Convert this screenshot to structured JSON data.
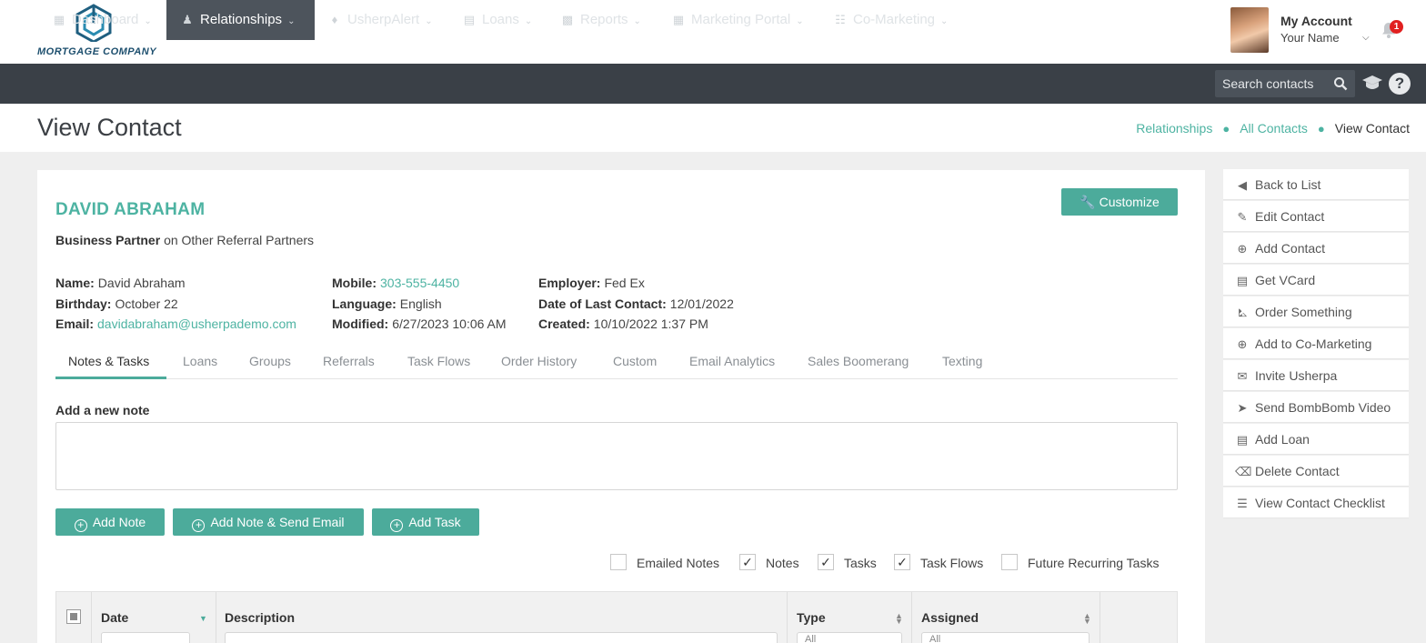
{
  "brand": {
    "logo_text": "MORTGAGE COMPANY"
  },
  "account": {
    "title": "My Account",
    "name": "Your Name",
    "notifications": "1"
  },
  "nav": {
    "items": [
      {
        "label": "Dashboard"
      },
      {
        "label": "Relationships"
      },
      {
        "label": "UsherpAlert"
      },
      {
        "label": "Loans"
      },
      {
        "label": "Reports"
      },
      {
        "label": "Marketing Portal"
      },
      {
        "label": "Co-Marketing"
      }
    ],
    "search_placeholder": "Search contacts"
  },
  "page": {
    "title": "View Contact"
  },
  "breadcrumb": {
    "items": [
      "Relationships",
      "All Contacts"
    ],
    "current": "View Contact"
  },
  "contact": {
    "name": "DAVID ABRAHAM",
    "role": "Business Partner",
    "on_text": "on Other Referral Partners",
    "customize_label": "Customize",
    "fields": {
      "name": {
        "label": "Name:",
        "value": "David Abraham"
      },
      "birthday": {
        "label": "Birthday:",
        "value": "October 22"
      },
      "email": {
        "label": "Email:",
        "value": "davidabraham@usherpademo.com"
      },
      "mobile": {
        "label": "Mobile:",
        "value": "303-555-4450"
      },
      "language": {
        "label": "Language:",
        "value": "English"
      },
      "modified": {
        "label": "Modified:",
        "value": "6/27/2023 10:06 AM"
      },
      "employer": {
        "label": "Employer:",
        "value": "Fed Ex"
      },
      "last_contact": {
        "label": "Date of Last Contact:",
        "value": "12/01/2022"
      },
      "created": {
        "label": "Created:",
        "value": "10/10/2022 1:37 PM"
      }
    }
  },
  "tabs": [
    "Notes & Tasks",
    "Loans",
    "Groups",
    "Referrals",
    "Task Flows",
    "Order History",
    "Custom",
    "Email Analytics",
    "Sales Boomerang",
    "Texting"
  ],
  "notes": {
    "label": "Add a new note",
    "buttons": {
      "add_note": "Add Note",
      "add_note_email": "Add Note & Send Email",
      "add_task": "Add Task"
    },
    "filters": [
      {
        "label": "Emailed Notes",
        "checked": false
      },
      {
        "label": "Notes",
        "checked": true
      },
      {
        "label": "Tasks",
        "checked": true
      },
      {
        "label": "Task Flows",
        "checked": true
      },
      {
        "label": "Future Recurring Tasks",
        "checked": false
      }
    ],
    "columns": {
      "date": "Date",
      "description": "Description",
      "type": "Type",
      "assigned": "Assigned"
    },
    "type_filter": "All",
    "assigned_filter": "All"
  },
  "side_actions": [
    "Back to List",
    "Edit Contact",
    "Add Contact",
    "Get VCard",
    "Order Something",
    "Add to Co-Marketing",
    "Invite Usherpa",
    "Send BombBomb Video",
    "Add Loan",
    "Delete Contact",
    "View Contact Checklist"
  ],
  "colors": {
    "accent": "#4db3a2",
    "button": "#4cab9b",
    "nav_bg": "#3a4047",
    "badge": "#e12020"
  }
}
